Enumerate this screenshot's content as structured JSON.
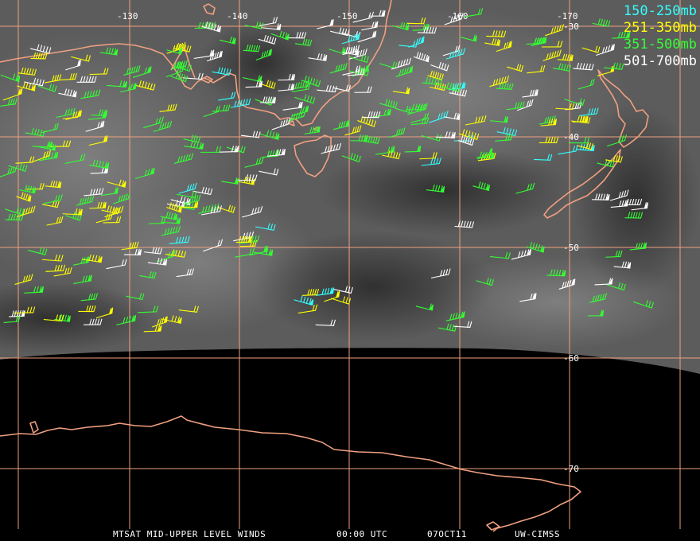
{
  "title": "MTSAT MID-UPPER LEVEL WINDS",
  "footer": {
    "product": "MTSAT MID-UPPER LEVEL WINDS",
    "time": "00:00 UTC",
    "date": "07OCT11",
    "source": "UW-CIMSS"
  },
  "legend": [
    {
      "label": "150-250mb",
      "color": "#33ffff"
    },
    {
      "label": "251-350mb",
      "color": "#ffff00"
    },
    {
      "label": "351-500mb",
      "color": "#33ff33"
    },
    {
      "label": "501-700mb",
      "color": "#ffffff"
    }
  ],
  "grid": {
    "longitude_labels": [
      "-130",
      "-140",
      "-150",
      "-160",
      "-170"
    ],
    "latitude_labels": [
      "-30",
      "-40",
      "-50",
      "-60",
      "-70"
    ],
    "color": "#f0a080"
  },
  "coastline_color": "#f0a080",
  "regions": [
    "Australia",
    "Tasmania",
    "New Zealand",
    "Antarctica"
  ]
}
